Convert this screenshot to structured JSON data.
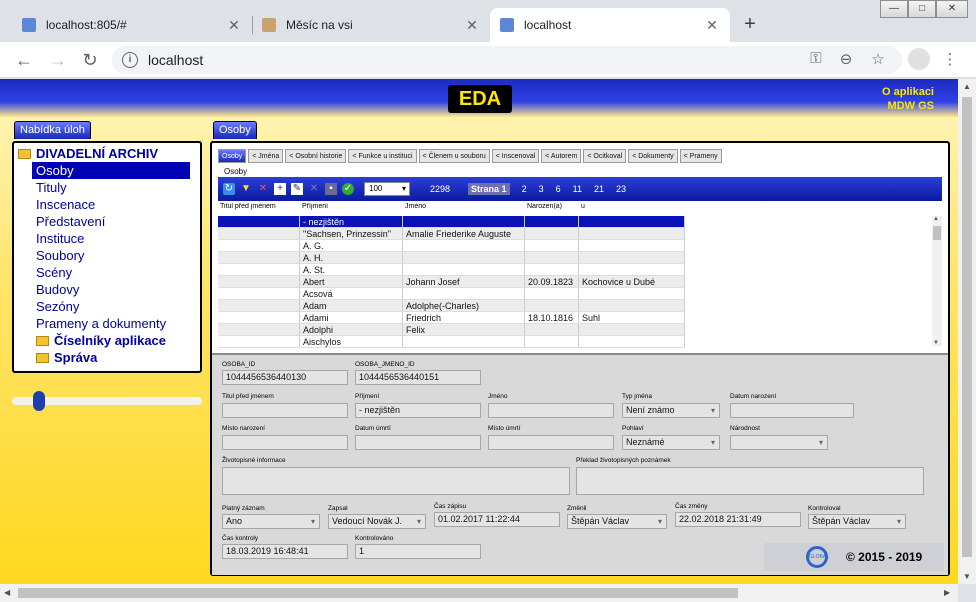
{
  "browser": {
    "tabs": [
      {
        "title": "localhost:805/#",
        "favicon_color": "#5b87d6"
      },
      {
        "title": "Měsíc na vsi",
        "favicon_color": "#c9a46a"
      },
      {
        "title": "localhost",
        "favicon_color": "#5b87d6"
      }
    ],
    "new_tab": "+",
    "window_buttons": [
      "—",
      "□",
      "✕"
    ],
    "url": "localhost"
  },
  "app": {
    "logo": "EDA",
    "about_line1": "O aplikaci",
    "about_line2": "MDW GS",
    "left_panel_tab": "Nabídka úloh",
    "main_panel_tab": "Osoby",
    "tree": {
      "root": "DIVADELNÍ ARCHIV",
      "items": [
        "Osoby",
        "Tituly",
        "Inscenace",
        "Představení",
        "Instituce",
        "Soubory",
        "Scény",
        "Budovy",
        "Sezóny",
        "Prameny a dokumenty"
      ],
      "selected": "Osoby",
      "folders": [
        "Číselníky aplikace",
        "Správa"
      ]
    },
    "slider_value": 0.12,
    "subtabs": [
      "Osoby",
      "< Jména",
      "< Osobní historie",
      "< Funkce u instituci",
      "< Členem u souboru",
      "< Inscenoval",
      "< Autorem",
      "< Ocitkoval",
      "< Dokumenty",
      "< Prameny"
    ],
    "subtab_active": "Osoby",
    "sublabel": "Osoby",
    "grid_toolbar": {
      "page_size": "100",
      "total": "2298",
      "page_label": "Strana 1",
      "pages": [
        "2",
        "3",
        "6",
        "11",
        "21",
        "23"
      ]
    },
    "grid": {
      "columns": [
        "Titul před jménem",
        "Příjmení",
        "Jméno",
        "Narozen(a)",
        "u"
      ],
      "rows": [
        [
          "",
          "- nezjištěn",
          "",
          "",
          ""
        ],
        [
          "",
          "\"Sachsen, Prinzessin\"",
          "Amalie Friederike Auguste",
          "",
          ""
        ],
        [
          "",
          "A. G.",
          "",
          "",
          ""
        ],
        [
          "",
          "A. H.",
          "",
          "",
          ""
        ],
        [
          "",
          "A. St.",
          "",
          "",
          ""
        ],
        [
          "",
          "Abert",
          "Johann Josef",
          "20.09.1823",
          "Kochovice u Dubé"
        ],
        [
          "",
          "Acsová",
          "",
          "",
          ""
        ],
        [
          "",
          "Adam",
          "Adolphe(-Charles)",
          "",
          ""
        ],
        [
          "",
          "Adami",
          "Friedrich",
          "18.10.1816",
          "Suhl"
        ],
        [
          "",
          "Adolphi",
          "Felix",
          "",
          ""
        ],
        [
          "",
          "Aischylos",
          "",
          "",
          ""
        ]
      ],
      "selected_row": 0
    },
    "form": {
      "osoba_id_label": "OSOBA_ID",
      "osoba_id": "1044456536440130",
      "osoba_jmeno_id_label": "OSOBA_JMENO_ID",
      "osoba_jmeno_id": "1044456536440151",
      "titul_label": "Titul před jménem",
      "titul": "",
      "prijmeni_label": "Příjmení",
      "prijmeni": "- nezjištěn",
      "jmeno_label": "Jméno",
      "jmeno": "",
      "typ_jmena_label": "Typ jména",
      "typ_jmena": "Není známo",
      "datum_narozeni_label": "Datum narození",
      "datum_narozeni": "",
      "misto_narozeni_label": "Místo narození",
      "misto_narozeni": "",
      "datum_umrti_label": "Datum úmrtí",
      "datum_umrti": "",
      "misto_umrti_label": "Místo úmrtí",
      "misto_umrti": "",
      "pohlavi_label": "Pohlaví",
      "pohlavi": "Neznámé",
      "narodnost_label": "Národnost",
      "narodnost": "",
      "zivot_label": "Životopisné informace",
      "preklad_label": "Překlad životopisných poznámek",
      "platny_label": "Platný záznam",
      "platny": "Ano",
      "zapsal_label": "Zapsal",
      "zapsal": "Vedoucí Novák J.",
      "cas_zapisu_label": "Čas zápisu",
      "cas_zapisu": "01.02.2017 11:22:44",
      "zmenil_label": "Změnil",
      "zmenil": "Štěpán Václav",
      "cas_zmeny_label": "Čas změny",
      "cas_zmeny": "22.02.2018 21:31:49",
      "kontroloval_label": "Kontroloval",
      "kontroloval": "Štěpán Václav",
      "cas_kontroly_label": "Čas kontroly",
      "cas_kontroly": "18.03.2019 16:48:41",
      "kontrolovano_label": "Kontrolováno",
      "kontrolovano": "1"
    },
    "logo_small": "GLOBAL",
    "copyright": "© 2015 - 2019"
  }
}
